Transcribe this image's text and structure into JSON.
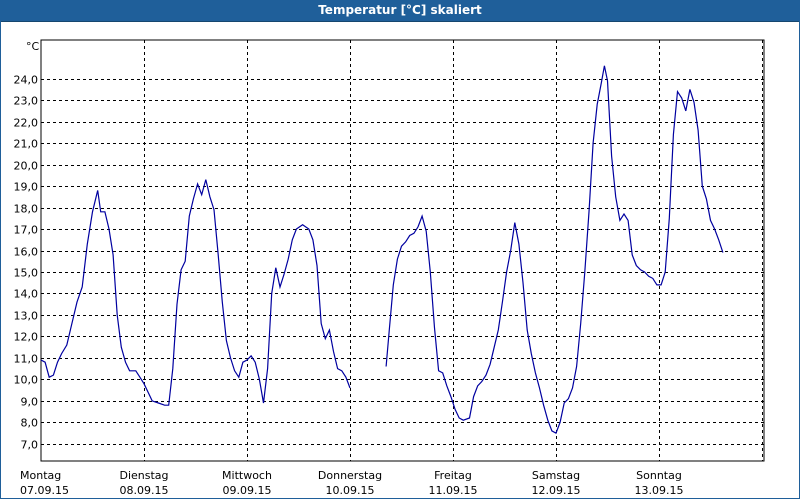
{
  "window": {
    "title": "Temperatur [°C] skaliert"
  },
  "chart_data": {
    "type": "line",
    "title": "Temperatur [°C] skaliert",
    "ylabel": "°C",
    "xlabel": "",
    "ylim": [
      6.2,
      25.8
    ],
    "xlim": [
      0,
      7.4
    ],
    "yticks": [
      "7,0",
      "8,0",
      "9,0",
      "10,0",
      "11,0",
      "12,0",
      "13,0",
      "14,0",
      "15,0",
      "16,0",
      "17,0",
      "18,0",
      "19,0",
      "20,0",
      "21,0",
      "22,0",
      "23,0",
      "24,0"
    ],
    "ytick_values": [
      7,
      8,
      9,
      10,
      11,
      12,
      13,
      14,
      15,
      16,
      17,
      18,
      19,
      20,
      21,
      22,
      23,
      24
    ],
    "grid": true,
    "xticks": [
      {
        "day": "Montag",
        "date": "07.09.15",
        "x": 0
      },
      {
        "day": "Dienstag",
        "date": "08.09.15",
        "x": 1
      },
      {
        "day": "Mittwoch",
        "date": "09.09.15",
        "x": 2
      },
      {
        "day": "Donnerstag",
        "date": "10.09.15",
        "x": 3
      },
      {
        "day": "Freitag",
        "date": "11.09.15",
        "x": 4
      },
      {
        "day": "Samstag",
        "date": "12.09.15",
        "x": 5
      },
      {
        "day": "Sonntag",
        "date": "13.09.15",
        "x": 6
      }
    ],
    "line_color": "#0000a0",
    "series": [
      {
        "segments": [
          [
            [
              0.0,
              10.9
            ],
            [
              0.04,
              10.8
            ],
            [
              0.08,
              10.1
            ],
            [
              0.12,
              10.2
            ],
            [
              0.16,
              10.8
            ],
            [
              0.2,
              11.2
            ],
            [
              0.25,
              11.6
            ],
            [
              0.3,
              12.6
            ],
            [
              0.35,
              13.6
            ],
            [
              0.4,
              14.3
            ],
            [
              0.45,
              16.3
            ],
            [
              0.5,
              17.8
            ],
            [
              0.55,
              18.8
            ],
            [
              0.58,
              17.8
            ],
            [
              0.62,
              17.8
            ],
            [
              0.66,
              17.0
            ],
            [
              0.7,
              15.8
            ],
            [
              0.74,
              13.0
            ],
            [
              0.78,
              11.5
            ],
            [
              0.82,
              10.8
            ],
            [
              0.86,
              10.4
            ],
            [
              0.92,
              10.4
            ],
            [
              0.96,
              10.1
            ],
            [
              1.0,
              9.8
            ],
            [
              1.04,
              9.4
            ],
            [
              1.08,
              9.0
            ],
            [
              1.14,
              8.9
            ],
            [
              1.2,
              8.8
            ],
            [
              1.24,
              8.8
            ],
            [
              1.28,
              10.5
            ],
            [
              1.32,
              13.5
            ],
            [
              1.36,
              15.1
            ],
            [
              1.4,
              15.5
            ],
            [
              1.44,
              17.6
            ],
            [
              1.48,
              18.4
            ],
            [
              1.52,
              19.1
            ],
            [
              1.56,
              18.6
            ],
            [
              1.6,
              19.3
            ],
            [
              1.64,
              18.5
            ],
            [
              1.68,
              17.9
            ],
            [
              1.72,
              15.8
            ],
            [
              1.76,
              13.6
            ],
            [
              1.8,
              11.8
            ],
            [
              1.84,
              11.0
            ],
            [
              1.88,
              10.4
            ],
            [
              1.92,
              10.1
            ],
            [
              1.96,
              10.8
            ],
            [
              2.0,
              10.9
            ],
            [
              2.04,
              11.1
            ],
            [
              2.08,
              10.8
            ],
            [
              2.12,
              10.0
            ],
            [
              2.16,
              8.9
            ],
            [
              2.2,
              10.5
            ],
            [
              2.24,
              14.0
            ],
            [
              2.28,
              15.2
            ],
            [
              2.32,
              14.3
            ],
            [
              2.36,
              14.9
            ],
            [
              2.4,
              15.6
            ],
            [
              2.44,
              16.5
            ],
            [
              2.48,
              17.0
            ],
            [
              2.54,
              17.2
            ],
            [
              2.6,
              17.0
            ],
            [
              2.64,
              16.5
            ],
            [
              2.68,
              15.3
            ],
            [
              2.72,
              12.6
            ],
            [
              2.76,
              11.9
            ],
            [
              2.8,
              12.3
            ],
            [
              2.84,
              11.3
            ],
            [
              2.88,
              10.5
            ],
            [
              2.92,
              10.4
            ],
            [
              2.96,
              10.1
            ],
            [
              3.0,
              9.6
            ]
          ],
          [
            [
              3.35,
              10.6
            ],
            [
              3.38,
              12.2
            ],
            [
              3.42,
              14.4
            ],
            [
              3.46,
              15.6
            ],
            [
              3.5,
              16.2
            ],
            [
              3.54,
              16.4
            ],
            [
              3.58,
              16.7
            ],
            [
              3.62,
              16.8
            ],
            [
              3.66,
              17.1
            ],
            [
              3.7,
              17.6
            ],
            [
              3.74,
              16.9
            ],
            [
              3.78,
              15.0
            ],
            [
              3.82,
              12.4
            ],
            [
              3.86,
              10.4
            ],
            [
              3.9,
              10.3
            ],
            [
              3.94,
              9.7
            ],
            [
              3.98,
              9.2
            ],
            [
              4.02,
              8.6
            ],
            [
              4.06,
              8.2
            ],
            [
              4.1,
              8.1
            ],
            [
              4.16,
              8.2
            ],
            [
              4.2,
              9.2
            ],
            [
              4.24,
              9.7
            ],
            [
              4.28,
              9.9
            ],
            [
              4.32,
              10.2
            ],
            [
              4.36,
              10.7
            ],
            [
              4.4,
              11.5
            ],
            [
              4.44,
              12.3
            ],
            [
              4.48,
              13.6
            ],
            [
              4.52,
              15.0
            ],
            [
              4.56,
              16.0
            ],
            [
              4.6,
              17.3
            ],
            [
              4.64,
              16.3
            ],
            [
              4.68,
              14.5
            ],
            [
              4.72,
              12.3
            ],
            [
              4.76,
              11.2
            ],
            [
              4.8,
              10.3
            ],
            [
              4.84,
              9.6
            ],
            [
              4.88,
              8.8
            ],
            [
              4.92,
              8.1
            ],
            [
              4.96,
              7.6
            ],
            [
              5.0,
              7.5
            ],
            [
              5.04,
              8.0
            ],
            [
              5.08,
              8.9
            ],
            [
              5.12,
              9.1
            ],
            [
              5.16,
              9.6
            ],
            [
              5.2,
              10.6
            ],
            [
              5.24,
              12.6
            ],
            [
              5.28,
              15.0
            ],
            [
              5.32,
              17.8
            ],
            [
              5.36,
              21.0
            ],
            [
              5.4,
              22.8
            ],
            [
              5.44,
              23.8
            ],
            [
              5.47,
              24.6
            ],
            [
              5.5,
              23.9
            ],
            [
              5.54,
              20.4
            ],
            [
              5.58,
              18.5
            ],
            [
              5.62,
              17.4
            ],
            [
              5.66,
              17.7
            ],
            [
              5.7,
              17.4
            ],
            [
              5.74,
              15.8
            ],
            [
              5.78,
              15.3
            ],
            [
              5.82,
              15.1
            ],
            [
              5.86,
              15.0
            ],
            [
              5.9,
              14.8
            ],
            [
              5.94,
              14.7
            ],
            [
              5.98,
              14.4
            ],
            [
              6.02,
              14.4
            ],
            [
              6.06,
              15.0
            ],
            [
              6.1,
              17.5
            ],
            [
              6.14,
              21.4
            ],
            [
              6.18,
              23.4
            ],
            [
              6.22,
              23.1
            ],
            [
              6.26,
              22.5
            ],
            [
              6.3,
              23.5
            ],
            [
              6.34,
              22.9
            ],
            [
              6.38,
              21.6
            ],
            [
              6.42,
              19.0
            ],
            [
              6.46,
              18.4
            ],
            [
              6.5,
              17.4
            ],
            [
              6.54,
              17.0
            ],
            [
              6.58,
              16.5
            ],
            [
              6.62,
              15.9
            ]
          ]
        ]
      }
    ]
  }
}
